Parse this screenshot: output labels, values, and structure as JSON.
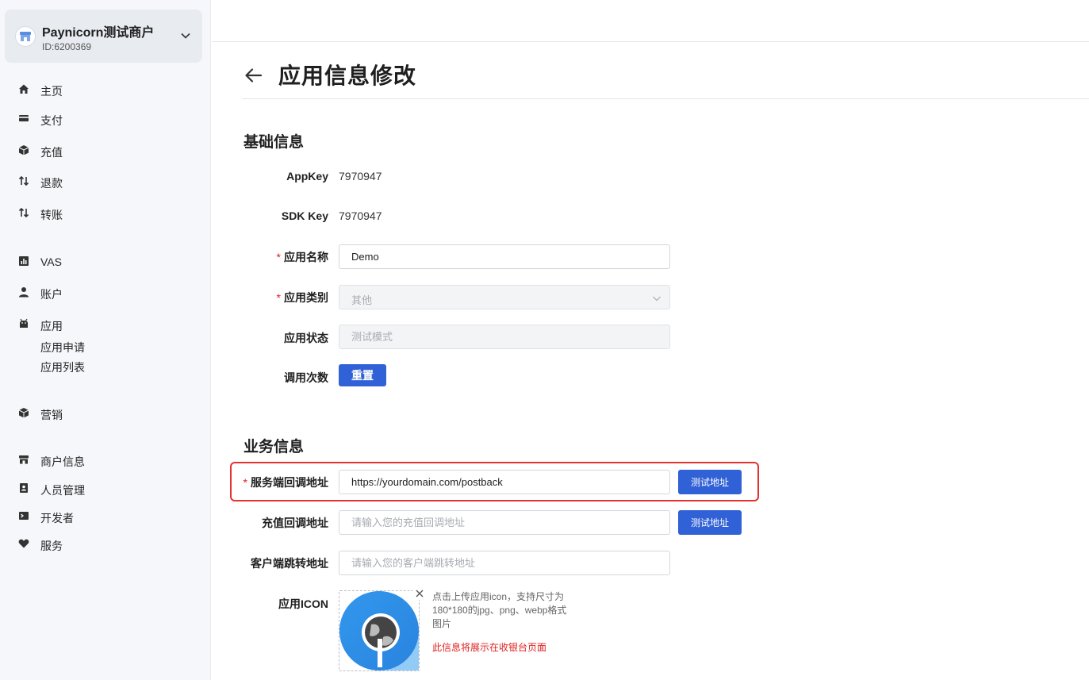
{
  "merchant": {
    "name": "Paynicorn测试商户",
    "id": "ID:6200369"
  },
  "nav": {
    "items": [
      {
        "label": "主页",
        "icon": "home-icon"
      },
      {
        "label": "支付",
        "icon": "wallet-icon"
      },
      {
        "label": "充值",
        "icon": "box-icon"
      },
      {
        "label": "退款",
        "icon": "swap-icon"
      },
      {
        "label": "转账",
        "icon": "swap-icon"
      },
      {
        "label": "VAS",
        "icon": "chart-icon"
      },
      {
        "label": "账户",
        "icon": "user-icon"
      },
      {
        "label": "应用",
        "icon": "android-icon"
      },
      {
        "label": "营销",
        "icon": "box-icon"
      },
      {
        "label": "商户信息",
        "icon": "store-icon"
      },
      {
        "label": "人员管理",
        "icon": "contacts-icon"
      },
      {
        "label": "开发者",
        "icon": "terminal-icon"
      },
      {
        "label": "服务",
        "icon": "heart-icon"
      }
    ],
    "app_sub": [
      "应用申请",
      "应用列表"
    ]
  },
  "page": {
    "title": "应用信息修改"
  },
  "basic": {
    "title": "基础信息",
    "appkey_label": "AppKey",
    "appkey_value": "7970947",
    "sdkkey_label": "SDK Key",
    "sdkkey_value": "7970947",
    "app_name_label": "应用名称",
    "app_name_value": "Demo",
    "app_category_label": "应用类别",
    "app_category_value": "其他",
    "app_status_label": "应用状态",
    "app_status_value": "测试模式",
    "call_count_label": "调用次数",
    "reset_button": "重置"
  },
  "business": {
    "title": "业务信息",
    "server_callback_label": "服务端回调地址",
    "server_callback_value": "https://yourdomain.com/postback",
    "recharge_callback_label": "充值回调地址",
    "recharge_callback_placeholder": "请输入您的充值回调地址",
    "client_redirect_label": "客户端跳转地址",
    "client_redirect_placeholder": "请输入您的客户端跳转地址",
    "test_button": "测试地址",
    "icon_label": "应用ICON",
    "upload_hint": "点击上传应用icon，支持尺寸为180*180的jpg、png、webp格式图片",
    "upload_note": "此信息将展示在收银台页面"
  },
  "colors": {
    "primary": "#3161d6",
    "required": "#e02020",
    "highlight": "#e5312f"
  }
}
